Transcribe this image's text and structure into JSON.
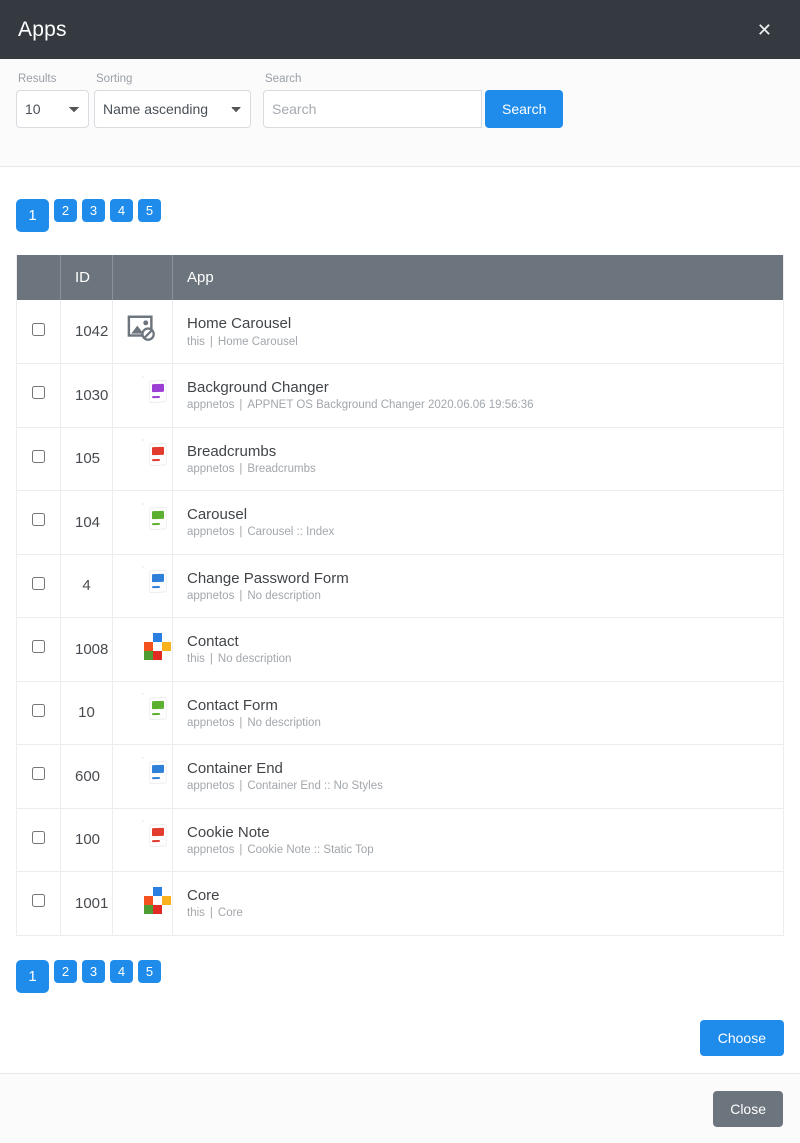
{
  "window": {
    "title": "Apps",
    "close_icon": "close-x-icon"
  },
  "filters": {
    "results_label": "Results",
    "results_value": "10",
    "results_options": [
      "10"
    ],
    "sorting_label": "Sorting",
    "sorting_value": "Name ascending",
    "sorting_options": [
      "Name ascending"
    ],
    "search_label": "Search",
    "search_placeholder": "Search",
    "search_value": "",
    "search_button": "Search"
  },
  "pagination": {
    "pages": [
      "1",
      "2",
      "3",
      "4",
      "5"
    ],
    "active": "1"
  },
  "table": {
    "headers": {
      "check": "",
      "id": "ID",
      "icon": "",
      "app": "App"
    },
    "rows": [
      {
        "id": "1042",
        "name": "Home Carousel",
        "owner": "this",
        "description": "Home Carousel",
        "icon": "broken-image-icon",
        "icon_color": "#6c757d",
        "checked": false
      },
      {
        "id": "1030",
        "name": "Background Changer",
        "owner": "appnetos",
        "description": "APPNET OS Background Changer 2020.06.06 19:56:36",
        "icon": "document-icon",
        "icon_color": "#9b3fd4",
        "checked": false
      },
      {
        "id": "105",
        "name": "Breadcrumbs",
        "owner": "appnetos",
        "description": "Breadcrumbs",
        "icon": "document-icon",
        "icon_color": "#e23b2e",
        "checked": false
      },
      {
        "id": "104",
        "name": "Carousel",
        "owner": "appnetos",
        "description": "Carousel :: Index",
        "icon": "document-icon",
        "icon_color": "#5bb12f",
        "checked": false
      },
      {
        "id": "4",
        "name": "Change Password Form",
        "owner": "appnetos",
        "description": "No description",
        "icon": "document-icon",
        "icon_color": "#2f80d8",
        "checked": false
      },
      {
        "id": "1008",
        "name": "Contact",
        "owner": "this",
        "description": "No description",
        "icon": "core-logo-icon",
        "icon_color": "#2a7fe0",
        "checked": false
      },
      {
        "id": "10",
        "name": "Contact Form",
        "owner": "appnetos",
        "description": "No description",
        "icon": "document-icon",
        "icon_color": "#5bb12f",
        "checked": false
      },
      {
        "id": "600",
        "name": "Container End",
        "owner": "appnetos",
        "description": "Container End :: No Styles",
        "icon": "document-icon",
        "icon_color": "#2f80d8",
        "checked": false
      },
      {
        "id": "100",
        "name": "Cookie Note",
        "owner": "appnetos",
        "description": "Cookie Note :: Static Top",
        "icon": "document-icon",
        "icon_color": "#e23b2e",
        "checked": false
      },
      {
        "id": "1001",
        "name": "Core",
        "owner": "this",
        "description": "Core",
        "icon": "core-logo-icon",
        "icon_color": "#2a7fe0",
        "checked": false
      }
    ],
    "separator": "|"
  },
  "actions": {
    "choose_label": "Choose",
    "close_label": "Close"
  },
  "colors": {
    "header_bg": "#343a40",
    "accent": "#1f8ceb",
    "table_header_bg": "#6c757d",
    "secondary": "#6c757d"
  }
}
